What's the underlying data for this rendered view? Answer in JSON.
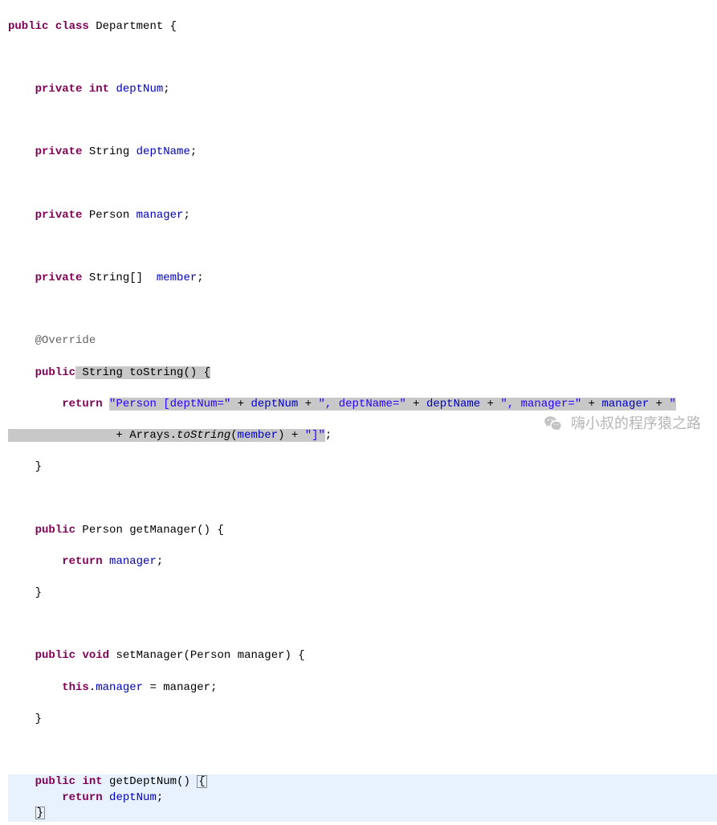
{
  "code": {
    "l1a": "public",
    "l1b": "class",
    "l1c": " Department {",
    "l3a": "private",
    "l3b": "int",
    "l3c": "deptNum",
    "l5a": "private",
    "l5b": " String ",
    "l5c": "deptName",
    "l7a": "private",
    "l7b": " Person ",
    "l7c": "manager",
    "l9a": "private",
    "l9b": " String[]  ",
    "l9c": "member",
    "l11": "@Override",
    "l12a": "public",
    "l12b": " String toString() {",
    "l13a": "return",
    "l13b": "\"Person [deptNum=\"",
    "l13c": " + ",
    "l13d": "deptNum",
    "l13e": " + ",
    "l13f": "\", deptName=\"",
    "l13g": " + ",
    "l13h": "deptName",
    "l13i": " + ",
    "l13j": "\", manager=\"",
    "l13k": " + ",
    "l13l": "manager",
    "l13m": " + ",
    "l13n": "\"",
    "l14a": "                + Arrays.",
    "l14b": "toString",
    "l14c": "(",
    "l14d": "member",
    "l14e": ") + ",
    "l14f": "\"]\"",
    "l14g": ";",
    "l15": "    }",
    "l17a": "public",
    "l17b": " Person getManager() {",
    "l18a": "return",
    "l18b": "manager",
    "l19": "    }",
    "l21a": "public",
    "l21b": "void",
    "l21c": " setManager(Person ",
    "l21d": "manager",
    "l21e": ") {",
    "l22a": "this",
    "l22b": ".",
    "l22c": "manager",
    "l22d": " = ",
    "l22e": "manager",
    "l23": "    }",
    "l25a": "public",
    "l25b": "int",
    "l25c": " getDeptNum() ",
    "l26a": "return",
    "l26b": "deptNum",
    "l27": "    }"
  },
  "watermark": {
    "text": "嗨小叔的程序猿之路"
  }
}
